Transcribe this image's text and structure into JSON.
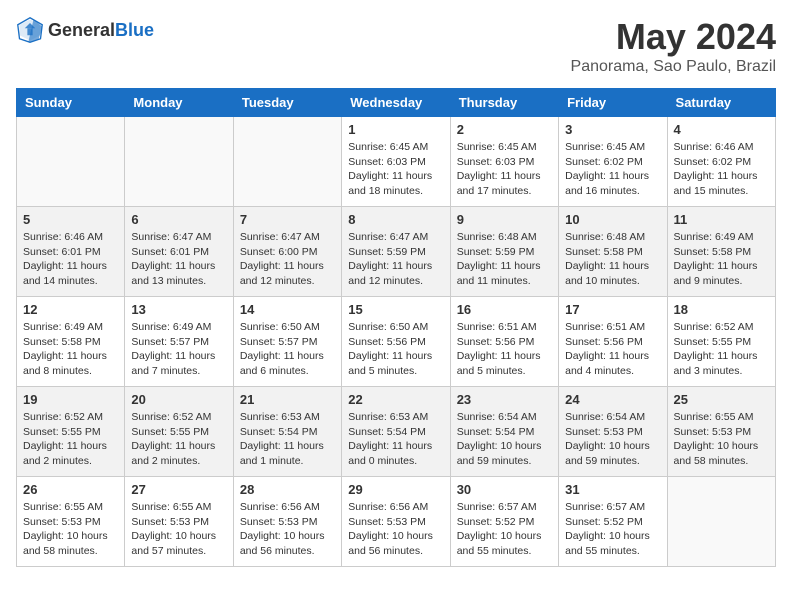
{
  "header": {
    "logo_general": "General",
    "logo_blue": "Blue",
    "title": "May 2024",
    "subtitle": "Panorama, Sao Paulo, Brazil"
  },
  "days_of_week": [
    "Sunday",
    "Monday",
    "Tuesday",
    "Wednesday",
    "Thursday",
    "Friday",
    "Saturday"
  ],
  "weeks": [
    [
      {
        "day": "",
        "info": ""
      },
      {
        "day": "",
        "info": ""
      },
      {
        "day": "",
        "info": ""
      },
      {
        "day": "1",
        "info": "Sunrise: 6:45 AM\nSunset: 6:03 PM\nDaylight: 11 hours\nand 18 minutes."
      },
      {
        "day": "2",
        "info": "Sunrise: 6:45 AM\nSunset: 6:03 PM\nDaylight: 11 hours\nand 17 minutes."
      },
      {
        "day": "3",
        "info": "Sunrise: 6:45 AM\nSunset: 6:02 PM\nDaylight: 11 hours\nand 16 minutes."
      },
      {
        "day": "4",
        "info": "Sunrise: 6:46 AM\nSunset: 6:02 PM\nDaylight: 11 hours\nand 15 minutes."
      }
    ],
    [
      {
        "day": "5",
        "info": "Sunrise: 6:46 AM\nSunset: 6:01 PM\nDaylight: 11 hours\nand 14 minutes."
      },
      {
        "day": "6",
        "info": "Sunrise: 6:47 AM\nSunset: 6:01 PM\nDaylight: 11 hours\nand 13 minutes."
      },
      {
        "day": "7",
        "info": "Sunrise: 6:47 AM\nSunset: 6:00 PM\nDaylight: 11 hours\nand 12 minutes."
      },
      {
        "day": "8",
        "info": "Sunrise: 6:47 AM\nSunset: 5:59 PM\nDaylight: 11 hours\nand 12 minutes."
      },
      {
        "day": "9",
        "info": "Sunrise: 6:48 AM\nSunset: 5:59 PM\nDaylight: 11 hours\nand 11 minutes."
      },
      {
        "day": "10",
        "info": "Sunrise: 6:48 AM\nSunset: 5:58 PM\nDaylight: 11 hours\nand 10 minutes."
      },
      {
        "day": "11",
        "info": "Sunrise: 6:49 AM\nSunset: 5:58 PM\nDaylight: 11 hours\nand 9 minutes."
      }
    ],
    [
      {
        "day": "12",
        "info": "Sunrise: 6:49 AM\nSunset: 5:58 PM\nDaylight: 11 hours\nand 8 minutes."
      },
      {
        "day": "13",
        "info": "Sunrise: 6:49 AM\nSunset: 5:57 PM\nDaylight: 11 hours\nand 7 minutes."
      },
      {
        "day": "14",
        "info": "Sunrise: 6:50 AM\nSunset: 5:57 PM\nDaylight: 11 hours\nand 6 minutes."
      },
      {
        "day": "15",
        "info": "Sunrise: 6:50 AM\nSunset: 5:56 PM\nDaylight: 11 hours\nand 5 minutes."
      },
      {
        "day": "16",
        "info": "Sunrise: 6:51 AM\nSunset: 5:56 PM\nDaylight: 11 hours\nand 5 minutes."
      },
      {
        "day": "17",
        "info": "Sunrise: 6:51 AM\nSunset: 5:56 PM\nDaylight: 11 hours\nand 4 minutes."
      },
      {
        "day": "18",
        "info": "Sunrise: 6:52 AM\nSunset: 5:55 PM\nDaylight: 11 hours\nand 3 minutes."
      }
    ],
    [
      {
        "day": "19",
        "info": "Sunrise: 6:52 AM\nSunset: 5:55 PM\nDaylight: 11 hours\nand 2 minutes."
      },
      {
        "day": "20",
        "info": "Sunrise: 6:52 AM\nSunset: 5:55 PM\nDaylight: 11 hours\nand 2 minutes."
      },
      {
        "day": "21",
        "info": "Sunrise: 6:53 AM\nSunset: 5:54 PM\nDaylight: 11 hours\nand 1 minute."
      },
      {
        "day": "22",
        "info": "Sunrise: 6:53 AM\nSunset: 5:54 PM\nDaylight: 11 hours\nand 0 minutes."
      },
      {
        "day": "23",
        "info": "Sunrise: 6:54 AM\nSunset: 5:54 PM\nDaylight: 10 hours\nand 59 minutes."
      },
      {
        "day": "24",
        "info": "Sunrise: 6:54 AM\nSunset: 5:53 PM\nDaylight: 10 hours\nand 59 minutes."
      },
      {
        "day": "25",
        "info": "Sunrise: 6:55 AM\nSunset: 5:53 PM\nDaylight: 10 hours\nand 58 minutes."
      }
    ],
    [
      {
        "day": "26",
        "info": "Sunrise: 6:55 AM\nSunset: 5:53 PM\nDaylight: 10 hours\nand 58 minutes."
      },
      {
        "day": "27",
        "info": "Sunrise: 6:55 AM\nSunset: 5:53 PM\nDaylight: 10 hours\nand 57 minutes."
      },
      {
        "day": "28",
        "info": "Sunrise: 6:56 AM\nSunset: 5:53 PM\nDaylight: 10 hours\nand 56 minutes."
      },
      {
        "day": "29",
        "info": "Sunrise: 6:56 AM\nSunset: 5:53 PM\nDaylight: 10 hours\nand 56 minutes."
      },
      {
        "day": "30",
        "info": "Sunrise: 6:57 AM\nSunset: 5:52 PM\nDaylight: 10 hours\nand 55 minutes."
      },
      {
        "day": "31",
        "info": "Sunrise: 6:57 AM\nSunset: 5:52 PM\nDaylight: 10 hours\nand 55 minutes."
      },
      {
        "day": "",
        "info": ""
      }
    ]
  ]
}
